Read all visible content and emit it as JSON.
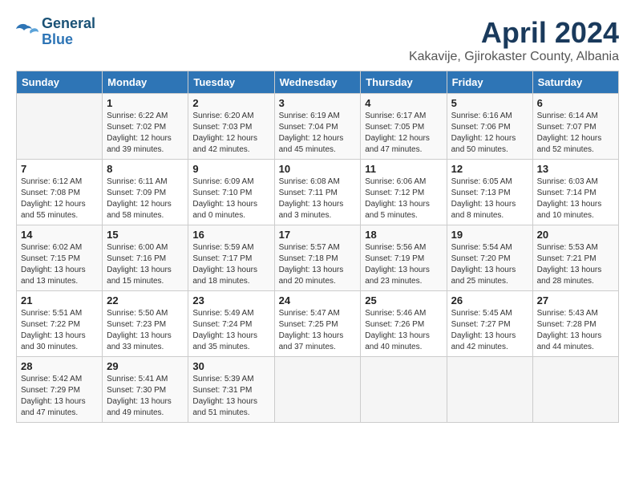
{
  "header": {
    "logo_line1": "General",
    "logo_line2": "Blue",
    "title": "April 2024",
    "subtitle": "Kakavije, Gjirokaster County, Albania"
  },
  "weekdays": [
    "Sunday",
    "Monday",
    "Tuesday",
    "Wednesday",
    "Thursday",
    "Friday",
    "Saturday"
  ],
  "weeks": [
    [
      {
        "day": "",
        "info": ""
      },
      {
        "day": "1",
        "info": "Sunrise: 6:22 AM\nSunset: 7:02 PM\nDaylight: 12 hours\nand 39 minutes."
      },
      {
        "day": "2",
        "info": "Sunrise: 6:20 AM\nSunset: 7:03 PM\nDaylight: 12 hours\nand 42 minutes."
      },
      {
        "day": "3",
        "info": "Sunrise: 6:19 AM\nSunset: 7:04 PM\nDaylight: 12 hours\nand 45 minutes."
      },
      {
        "day": "4",
        "info": "Sunrise: 6:17 AM\nSunset: 7:05 PM\nDaylight: 12 hours\nand 47 minutes."
      },
      {
        "day": "5",
        "info": "Sunrise: 6:16 AM\nSunset: 7:06 PM\nDaylight: 12 hours\nand 50 minutes."
      },
      {
        "day": "6",
        "info": "Sunrise: 6:14 AM\nSunset: 7:07 PM\nDaylight: 12 hours\nand 52 minutes."
      }
    ],
    [
      {
        "day": "7",
        "info": "Sunrise: 6:12 AM\nSunset: 7:08 PM\nDaylight: 12 hours\nand 55 minutes."
      },
      {
        "day": "8",
        "info": "Sunrise: 6:11 AM\nSunset: 7:09 PM\nDaylight: 12 hours\nand 58 minutes."
      },
      {
        "day": "9",
        "info": "Sunrise: 6:09 AM\nSunset: 7:10 PM\nDaylight: 13 hours\nand 0 minutes."
      },
      {
        "day": "10",
        "info": "Sunrise: 6:08 AM\nSunset: 7:11 PM\nDaylight: 13 hours\nand 3 minutes."
      },
      {
        "day": "11",
        "info": "Sunrise: 6:06 AM\nSunset: 7:12 PM\nDaylight: 13 hours\nand 5 minutes."
      },
      {
        "day": "12",
        "info": "Sunrise: 6:05 AM\nSunset: 7:13 PM\nDaylight: 13 hours\nand 8 minutes."
      },
      {
        "day": "13",
        "info": "Sunrise: 6:03 AM\nSunset: 7:14 PM\nDaylight: 13 hours\nand 10 minutes."
      }
    ],
    [
      {
        "day": "14",
        "info": "Sunrise: 6:02 AM\nSunset: 7:15 PM\nDaylight: 13 hours\nand 13 minutes."
      },
      {
        "day": "15",
        "info": "Sunrise: 6:00 AM\nSunset: 7:16 PM\nDaylight: 13 hours\nand 15 minutes."
      },
      {
        "day": "16",
        "info": "Sunrise: 5:59 AM\nSunset: 7:17 PM\nDaylight: 13 hours\nand 18 minutes."
      },
      {
        "day": "17",
        "info": "Sunrise: 5:57 AM\nSunset: 7:18 PM\nDaylight: 13 hours\nand 20 minutes."
      },
      {
        "day": "18",
        "info": "Sunrise: 5:56 AM\nSunset: 7:19 PM\nDaylight: 13 hours\nand 23 minutes."
      },
      {
        "day": "19",
        "info": "Sunrise: 5:54 AM\nSunset: 7:20 PM\nDaylight: 13 hours\nand 25 minutes."
      },
      {
        "day": "20",
        "info": "Sunrise: 5:53 AM\nSunset: 7:21 PM\nDaylight: 13 hours\nand 28 minutes."
      }
    ],
    [
      {
        "day": "21",
        "info": "Sunrise: 5:51 AM\nSunset: 7:22 PM\nDaylight: 13 hours\nand 30 minutes."
      },
      {
        "day": "22",
        "info": "Sunrise: 5:50 AM\nSunset: 7:23 PM\nDaylight: 13 hours\nand 33 minutes."
      },
      {
        "day": "23",
        "info": "Sunrise: 5:49 AM\nSunset: 7:24 PM\nDaylight: 13 hours\nand 35 minutes."
      },
      {
        "day": "24",
        "info": "Sunrise: 5:47 AM\nSunset: 7:25 PM\nDaylight: 13 hours\nand 37 minutes."
      },
      {
        "day": "25",
        "info": "Sunrise: 5:46 AM\nSunset: 7:26 PM\nDaylight: 13 hours\nand 40 minutes."
      },
      {
        "day": "26",
        "info": "Sunrise: 5:45 AM\nSunset: 7:27 PM\nDaylight: 13 hours\nand 42 minutes."
      },
      {
        "day": "27",
        "info": "Sunrise: 5:43 AM\nSunset: 7:28 PM\nDaylight: 13 hours\nand 44 minutes."
      }
    ],
    [
      {
        "day": "28",
        "info": "Sunrise: 5:42 AM\nSunset: 7:29 PM\nDaylight: 13 hours\nand 47 minutes."
      },
      {
        "day": "29",
        "info": "Sunrise: 5:41 AM\nSunset: 7:30 PM\nDaylight: 13 hours\nand 49 minutes."
      },
      {
        "day": "30",
        "info": "Sunrise: 5:39 AM\nSunset: 7:31 PM\nDaylight: 13 hours\nand 51 minutes."
      },
      {
        "day": "",
        "info": ""
      },
      {
        "day": "",
        "info": ""
      },
      {
        "day": "",
        "info": ""
      },
      {
        "day": "",
        "info": ""
      }
    ]
  ]
}
